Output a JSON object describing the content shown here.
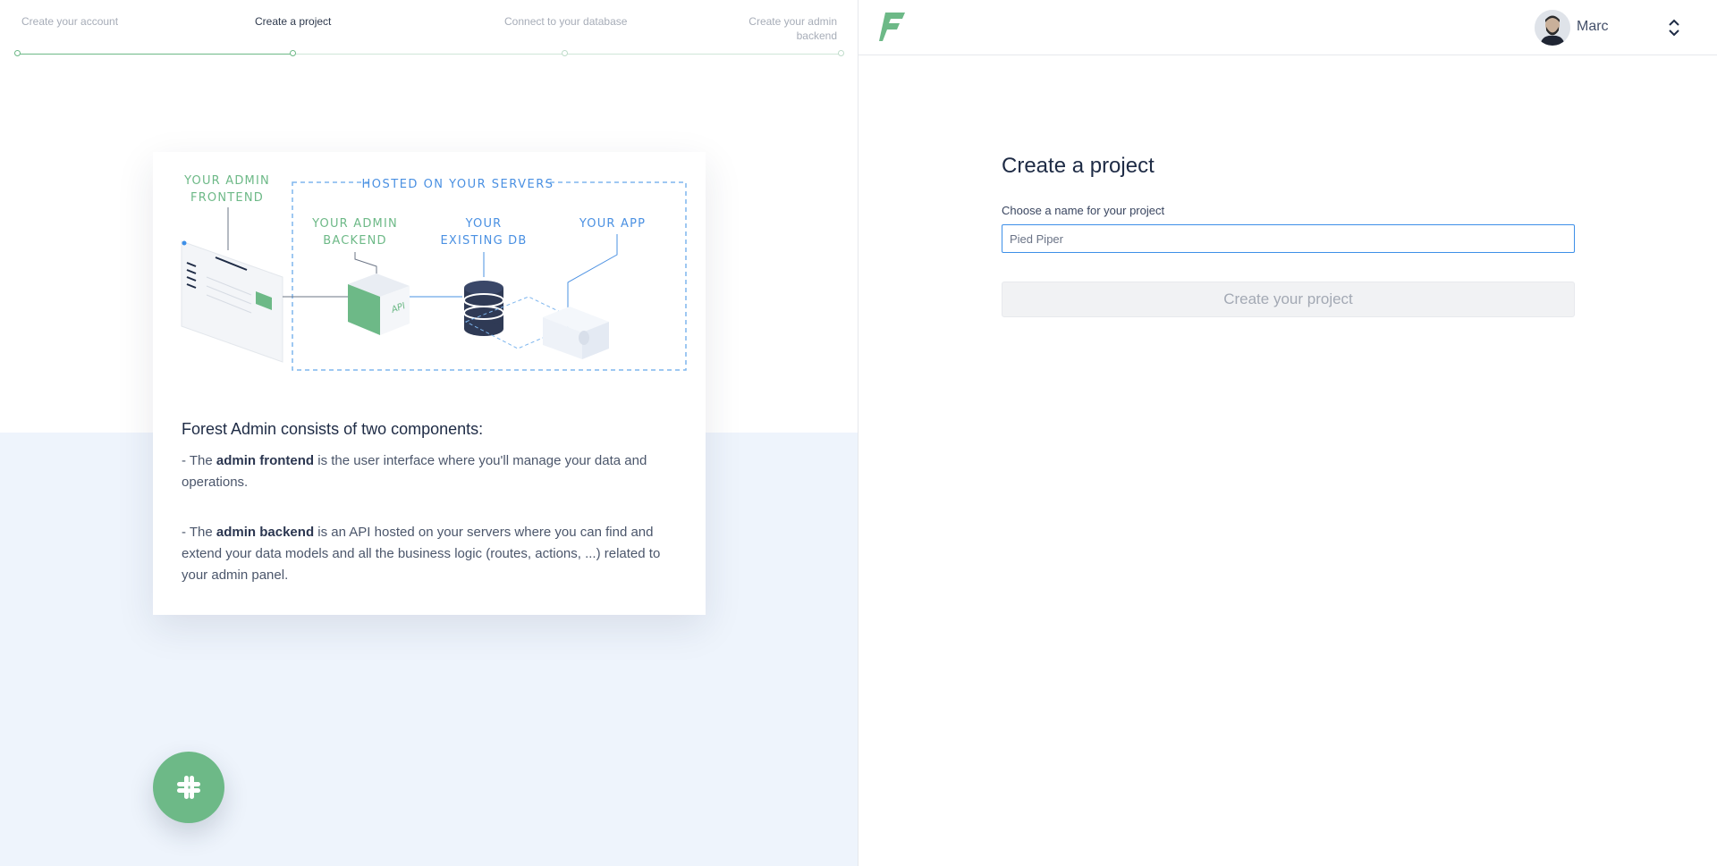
{
  "stepper": {
    "steps": [
      {
        "label": "Create your account",
        "state": "done"
      },
      {
        "label": "Create a project",
        "state": "active"
      },
      {
        "label": "Connect to your database",
        "state": "todo"
      },
      {
        "label": "Create your admin backend",
        "state": "todo"
      }
    ]
  },
  "illustration": {
    "frontend_label": "YOUR ADMIN FRONTEND",
    "hosted_label": "HOSTED ON YOUR SERVERS",
    "backend_label": "YOUR ADMIN BACKEND",
    "db_label": "YOUR EXISTING DB",
    "app_label": "YOUR APP",
    "api_tag": "API"
  },
  "info": {
    "title": "Forest Admin consists of two components:",
    "para1_prefix": "- The ",
    "para1_bold": "admin frontend",
    "para1_rest": " is the user interface where you'll manage your data and operations.",
    "para2_prefix": "- The ",
    "para2_bold": "admin backend",
    "para2_rest": " is an API hosted on your servers where you can find and extend your data models and all the business logic (routes, actions, ...) related to your admin panel."
  },
  "slack": {
    "icon": "slack-icon"
  },
  "header": {
    "user_name": "Marc"
  },
  "form": {
    "title": "Create a project",
    "name_label": "Choose a name for your project",
    "name_value": "Pied Piper",
    "submit_label": "Create your project"
  },
  "colors": {
    "brand_green": "#6db987",
    "accent_blue": "#3d8fe8",
    "hosted_blue": "#4a90e2",
    "dark_text": "#1e2b45"
  }
}
